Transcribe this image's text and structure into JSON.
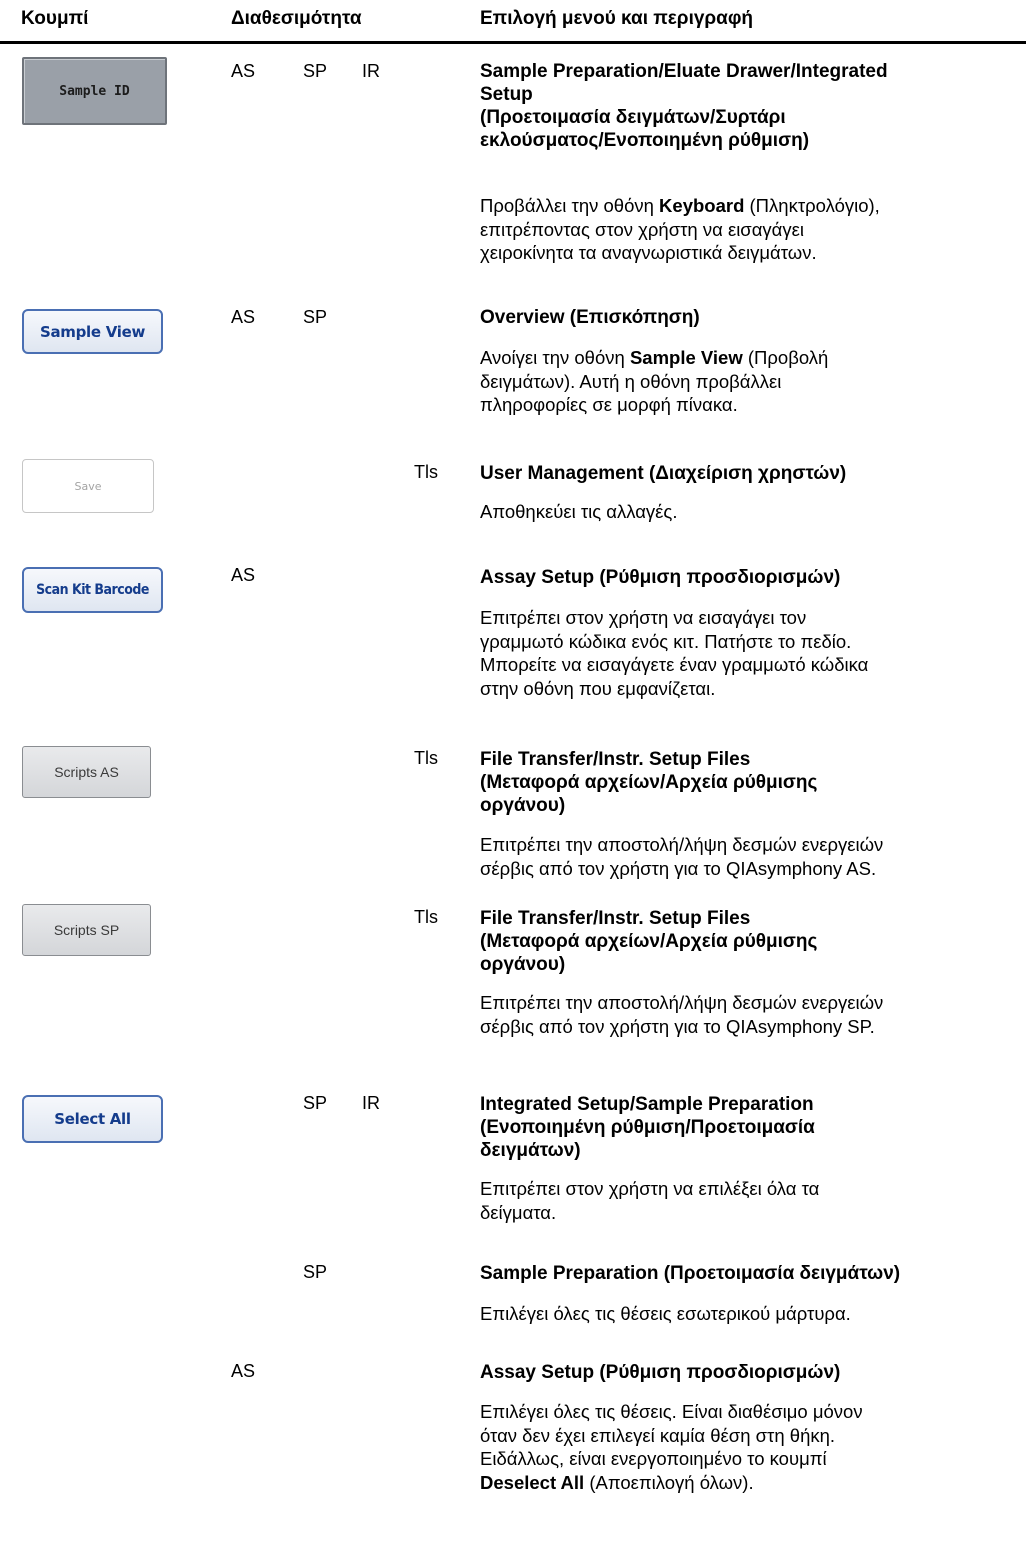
{
  "header": {
    "col1": "Κουμπί",
    "col2": "Διαθεσιμότητα",
    "col3": "Επιλογή μενού και περιγραφή"
  },
  "rows": [
    {
      "button_label": "Sample ID",
      "as": "AS",
      "sp": "SP",
      "ir": "IR",
      "tls": "",
      "menu": [
        "Sample Preparation/Eluate Drawer/Integrated",
        "Setup",
        "(Προετοιμασία δειγμάτων/Συρτάρι",
        "εκλούσματος/Ενοποιημένη ρύθμιση)"
      ],
      "desc": {
        "l1_pre": "Προβάλλει την οθόνη ",
        "l1_bold": "Keyboard",
        "l1_post": " (Πληκτρολόγιο),",
        "l2": "επιτρέποντας στον χρήστη να εισαγάγει",
        "l3": "χειροκίνητα τα αναγνωριστικά δειγμάτων."
      }
    },
    {
      "button_label": "Sample View",
      "as": "AS",
      "sp": "SP",
      "ir": "",
      "tls": "",
      "menu": [
        "Overview (Επισκόπηση)"
      ],
      "desc": {
        "l1_pre": "Ανοίγει την οθόνη ",
        "l1_bold": "Sample View",
        "l1_post": " (Προβολή",
        "l2": "δειγμάτων). Αυτή η οθόνη προβάλλει",
        "l3": "πληροφορίες σε μορφή πίνακα."
      }
    },
    {
      "button_label": "Save",
      "as": "",
      "sp": "",
      "ir": "",
      "tls": "Tls",
      "menu": [
        "User Management (Διαχείριση χρηστών)"
      ],
      "desc": {
        "l1": "Αποθηκεύει τις αλλαγές."
      }
    },
    {
      "button_label": "Scan Kit Barcode",
      "as": "AS",
      "sp": "",
      "ir": "",
      "tls": "",
      "menu": [
        "Assay Setup (Ρύθμιση προσδιορισμών)"
      ],
      "desc": {
        "l1": "Επιτρέπει στον χρήστη να εισαγάγει τον",
        "l2": "γραμμωτό κώδικα ενός κιτ. Πατήστε το πεδίο.",
        "l3": "Μπορείτε να εισαγάγετε έναν γραμμωτό κώδικα",
        "l4": "στην οθόνη που εμφανίζεται."
      }
    },
    {
      "button_label": "Scripts AS",
      "as": "",
      "sp": "",
      "ir": "",
      "tls": "Tls",
      "menu": [
        "File Transfer/Instr. Setup Files",
        "(Μεταφορά αρχείων/Αρχεία ρύθμισης",
        "οργάνου)"
      ],
      "desc": {
        "l1": "Επιτρέπει την αποστολή/λήψη δεσμών ενεργειών",
        "l2": "σέρβις από τον χρήστη για το QIAsymphony AS."
      }
    },
    {
      "button_label": "Scripts SP",
      "as": "",
      "sp": "",
      "ir": "",
      "tls": "Tls",
      "menu": [
        "File Transfer/Instr. Setup Files",
        "(Μεταφορά αρχείων/Αρχεία ρύθμισης",
        "οργάνου)"
      ],
      "desc": {
        "l1": "Επιτρέπει την αποστολή/λήψη δεσμών ενεργειών",
        "l2": "σέρβις από τον χρήστη για το QIAsymphony SP."
      }
    },
    {
      "button_label": "Select All",
      "as": "",
      "sp": "SP",
      "ir": "IR",
      "tls": "",
      "menu": [
        "Integrated Setup/Sample Preparation",
        "(Ενοποιημένη ρύθμιση/Προετοιμασία",
        "δειγμάτων)"
      ],
      "desc": {
        "l1": "Επιτρέπει στον χρήστη να επιλέξει όλα τα",
        "l2": "δείγματα."
      }
    },
    {
      "button_label": "",
      "as": "",
      "sp": "SP",
      "ir": "",
      "tls": "",
      "menu": [
        "Sample Preparation (Προετοιμασία δειγμάτων)"
      ],
      "desc": {
        "l1": "Επιλέγει όλες τις θέσεις εσωτερικού μάρτυρα."
      }
    },
    {
      "button_label": "",
      "as": "AS",
      "sp": "",
      "ir": "",
      "tls": "",
      "menu": [
        "Assay Setup (Ρύθμιση προσδιορισμών)"
      ],
      "desc": {
        "l1": "Επιλέγει όλες τις θέσεις. Είναι διαθέσιμο μόνον",
        "l2": "όταν δεν έχει επιλεγεί καμία θέση στη θήκη.",
        "l3": "Ειδάλλως, είναι ενεργοποιημένο το κουμπί",
        "l4_bold": "Deselect All",
        "l4_post": " (Αποεπιλογή όλων)."
      }
    }
  ]
}
